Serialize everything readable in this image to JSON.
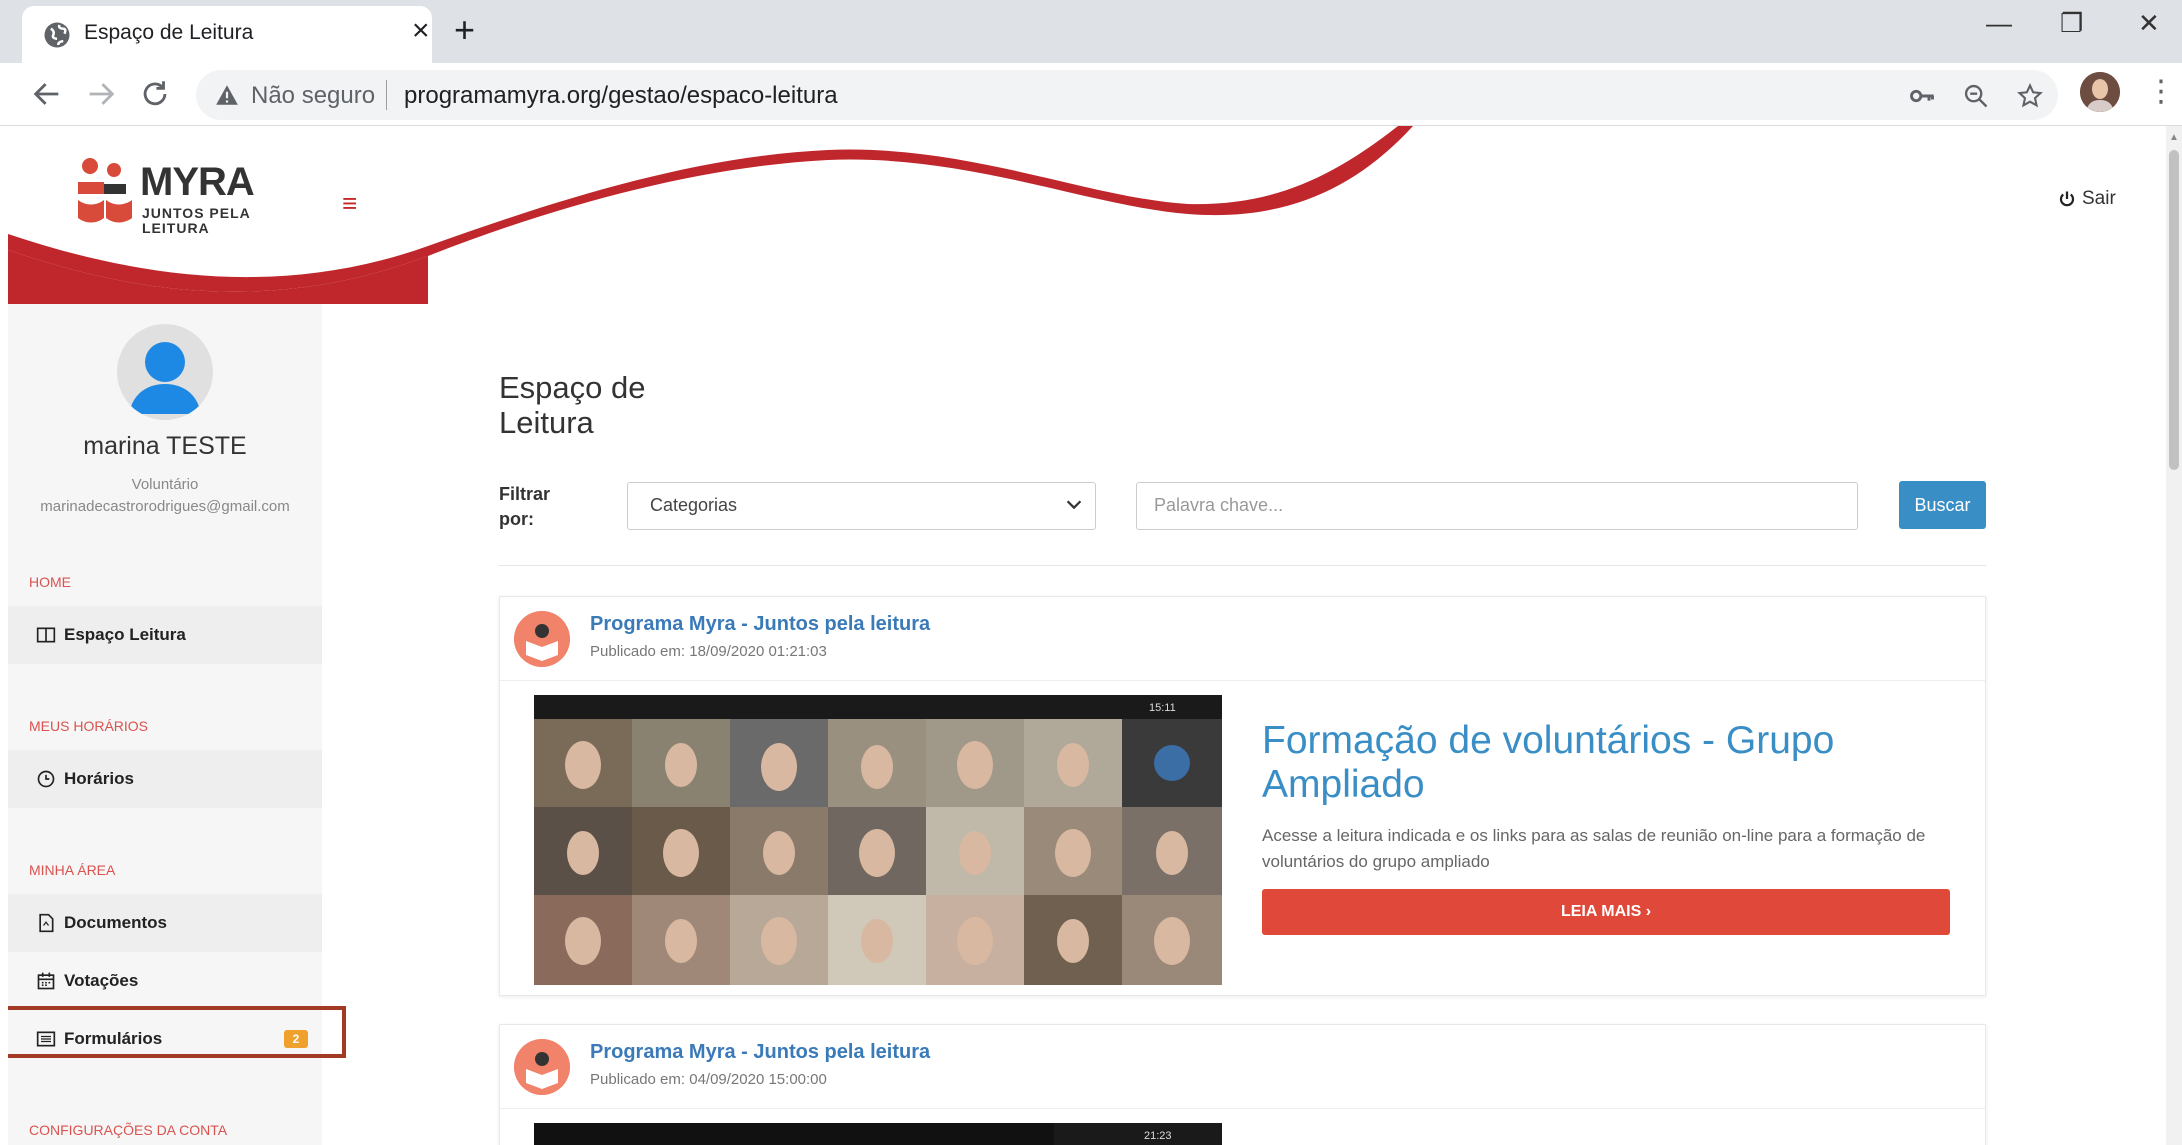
{
  "browser": {
    "tab_title": "Espaço de Leitura",
    "tab_close": "×",
    "new_tab": "+",
    "security_label": "Não seguro",
    "url": "programamyra.org/gestao/espaco-leitura",
    "minimize": "—",
    "restore": "❐",
    "close": "✕",
    "menu": "⋮"
  },
  "header": {
    "logo_word": "MYRA",
    "logo_sub_1": "JUNTOS PELA",
    "logo_sub_2": "LEITURA",
    "menu_icon": "≡",
    "logout_label": "Sair",
    "accent_color": "#c62828"
  },
  "profile": {
    "name": "marina TESTE",
    "role": "Voluntário",
    "email": "marinadecastrorodrigues@gmail.com"
  },
  "sidebar": {
    "sections": [
      {
        "title": "HOME",
        "items": [
          {
            "label": "Espaço Leitura",
            "icon": "book-open-icon"
          }
        ]
      },
      {
        "title": "MEUS HORÁRIOS",
        "items": [
          {
            "label": "Horários",
            "icon": "clock-icon"
          }
        ]
      },
      {
        "title": "MINHA ÁREA",
        "items": [
          {
            "label": "Documentos",
            "icon": "document-icon"
          },
          {
            "label": "Votações",
            "icon": "calendar-icon"
          },
          {
            "label": "Formulários",
            "icon": "list-icon",
            "badge": "2"
          }
        ]
      },
      {
        "title": "CONFIGURAÇÕES DA CONTA",
        "items": []
      }
    ]
  },
  "main": {
    "title": "Espaço de Leitura",
    "filter_label": "Filtrar por:",
    "category_select": "Categorias",
    "keyword_placeholder": "Palavra chave...",
    "search_button": "Buscar",
    "button_color": "#3a8ec6"
  },
  "posts": [
    {
      "author": "Programa Myra - Juntos pela leitura",
      "date": "Publicado em: 18/09/2020 01:21:03",
      "title": "Formação de voluntários - Grupo Ampliado",
      "description": "Acesse a leitura indicada e os links para as salas de reunião on-line para a formação de voluntários do grupo ampliado",
      "read_more": "LEIA MAIS ›",
      "meeting_time": "15:11"
    },
    {
      "author": "Programa Myra - Juntos pela leitura",
      "date": "Publicado em: 04/09/2020 15:00:00",
      "meeting_time": "21:23"
    }
  ]
}
